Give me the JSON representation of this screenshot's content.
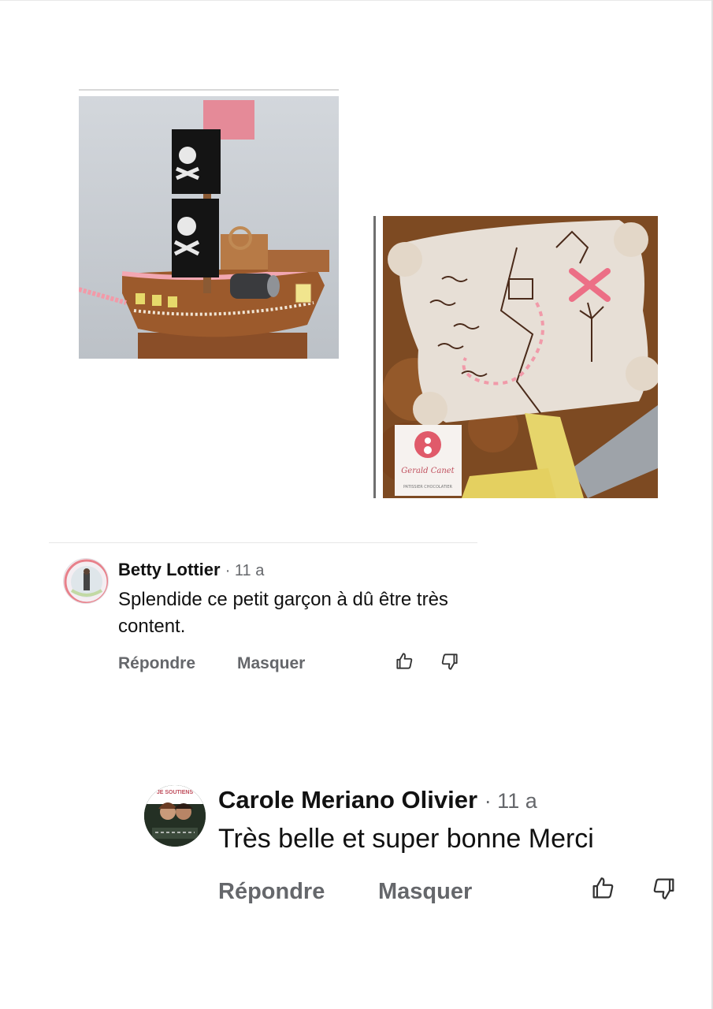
{
  "photos": [
    {
      "name": "pirate-ship-cake"
    },
    {
      "name": "treasure-map-cake",
      "logo_text": "Gerald Canet",
      "logo_subtitle": "PATISSIER CHOCOLATIER"
    }
  ],
  "comments": [
    {
      "author": "Betty Lottier",
      "time": "· 11 a",
      "text": "Splendide ce petit garçon à dû être très content.",
      "reply_label": "Répondre",
      "hide_label": "Masquer",
      "like_icon": "thumbs-up-icon",
      "dislike_icon": "thumbs-down-icon"
    },
    {
      "author": "Carole Meriano Olivier",
      "time": "· 11 a",
      "text": "Très belle et super bonne Merci",
      "reply_label": "Répondre",
      "hide_label": "Masquer",
      "like_icon": "thumbs-up-icon",
      "dislike_icon": "thumbs-down-icon",
      "avatar_banner": "JE SOUTIENS"
    }
  ],
  "colors": {
    "text": "#111111",
    "muted": "#65676b",
    "pink_accent": "#e8808a"
  }
}
